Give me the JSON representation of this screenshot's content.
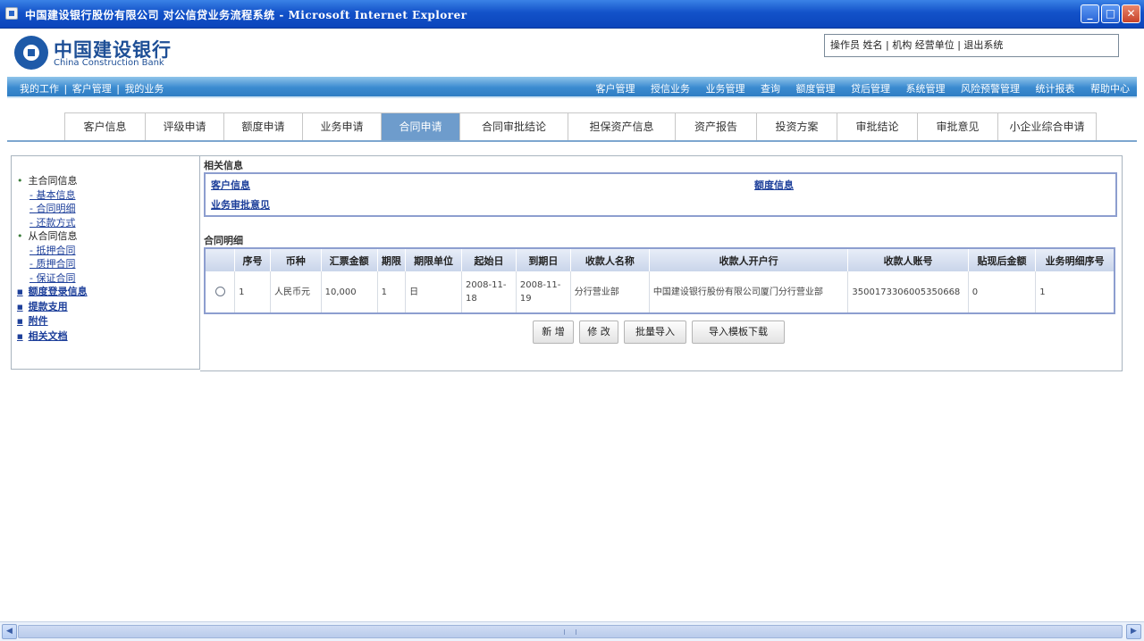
{
  "window": {
    "title": "中国建设银行股份有限公司 对公信贷业务流程系统 - Microsoft Internet Explorer",
    "minimize": "_",
    "maximize": "□",
    "close": "✕"
  },
  "header": {
    "logo_cn": "中国建设银行",
    "logo_en": "China Construction Bank",
    "user_info": "操作员 姓名 | 机构 经营单位 | 退出系统"
  },
  "navbar": {
    "left": [
      "我的工作",
      "|",
      "客户管理",
      "|",
      "我的业务"
    ],
    "right": [
      "客户管理",
      "授信业务",
      "业务管理",
      "查询",
      "额度管理",
      "贷后管理",
      "系统管理",
      "风险预警管理",
      "统计报表",
      "帮助中心"
    ]
  },
  "tabs": [
    {
      "label": "客户信息",
      "active": false
    },
    {
      "label": "评级申请",
      "active": false
    },
    {
      "label": "额度申请",
      "active": false
    },
    {
      "label": "业务申请",
      "active": false
    },
    {
      "label": "合同申请",
      "active": true
    },
    {
      "label": "合同审批结论",
      "active": false
    },
    {
      "label": "担保资产信息",
      "active": false
    },
    {
      "label": "资产报告",
      "active": false
    },
    {
      "label": "投资方案",
      "active": false
    },
    {
      "label": "审批结论",
      "active": false
    },
    {
      "label": "审批意见",
      "active": false
    },
    {
      "label": "小企业综合申请",
      "active": false
    }
  ],
  "tree": {
    "main_contract": "主合同信息",
    "main_children": [
      "基本信息",
      "合同明细",
      "还款方式"
    ],
    "sub_contract": "从合同信息",
    "sub_children": [
      "抵押合同",
      "质押合同",
      "保证合同"
    ],
    "links": [
      "额度登录信息",
      "提款支用",
      "附件",
      "相关文档"
    ]
  },
  "related": {
    "title": "相关信息",
    "customer_link": "客户信息",
    "limit_link": "额度信息",
    "approval_link": "业务审批意见"
  },
  "contract": {
    "title": "合同明细",
    "columns": [
      "",
      "序号",
      "币种",
      "汇票金额",
      "期限",
      "期限单位",
      "起始日",
      "到期日",
      "收款人名称",
      "收款人开户行",
      "收款人账号",
      "贴现后金额",
      "业务明细序号"
    ],
    "rows": [
      {
        "seq": "1",
        "currency": "人民币元",
        "amount": "10,000",
        "term": "1",
        "unit": "日",
        "start": "2008-11-18",
        "end": "2008-11-19",
        "payee": "分行营业部",
        "bank": "中国建设银行股份有限公司厦门分行营业部",
        "account": "3500173306005350668",
        "discounted": "0",
        "detail_seq": "1"
      }
    ]
  },
  "buttons": {
    "add": "新 增",
    "modify": "修 改",
    "batch_import": "批量导入",
    "template_download": "导入模板下载"
  },
  "scrollbar": {
    "left_arrow": "◀",
    "right_arrow": "▶"
  }
}
